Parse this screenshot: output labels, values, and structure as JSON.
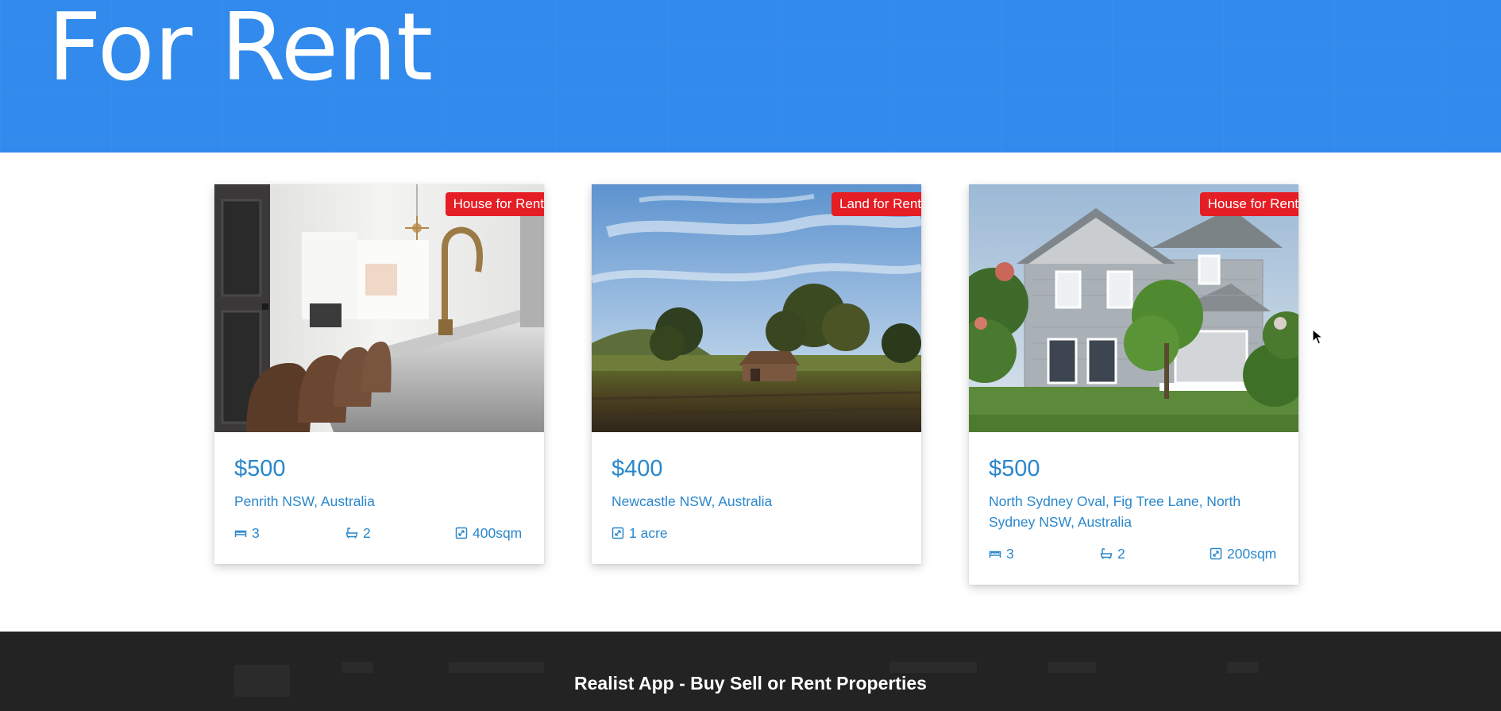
{
  "hero": {
    "title": "For Rent"
  },
  "listings": [
    {
      "badge": "House for Rent",
      "price": "$500",
      "address": "Penrith NSW, Australia",
      "beds": "3",
      "baths": "2",
      "area": "400sqm",
      "photo_icon": "kitchen-photo"
    },
    {
      "badge": "Land for Rent",
      "price": "$400",
      "address": "Newcastle NSW, Australia",
      "area": "1 acre",
      "photo_icon": "farmland-photo"
    },
    {
      "badge": "House for Rent",
      "price": "$500",
      "address": "North Sydney Oval, Fig Tree Lane, North Sydney NSW, Australia",
      "beds": "3",
      "baths": "2",
      "area": "200sqm",
      "photo_icon": "house-photo"
    }
  ],
  "footer": {
    "title": "Realist App - Buy Sell or Rent Properties"
  },
  "colors": {
    "hero_bg": "#318aec",
    "accent_text": "#2a87cc",
    "badge_bg": "#e51d24",
    "footer_bg": "#232323"
  }
}
